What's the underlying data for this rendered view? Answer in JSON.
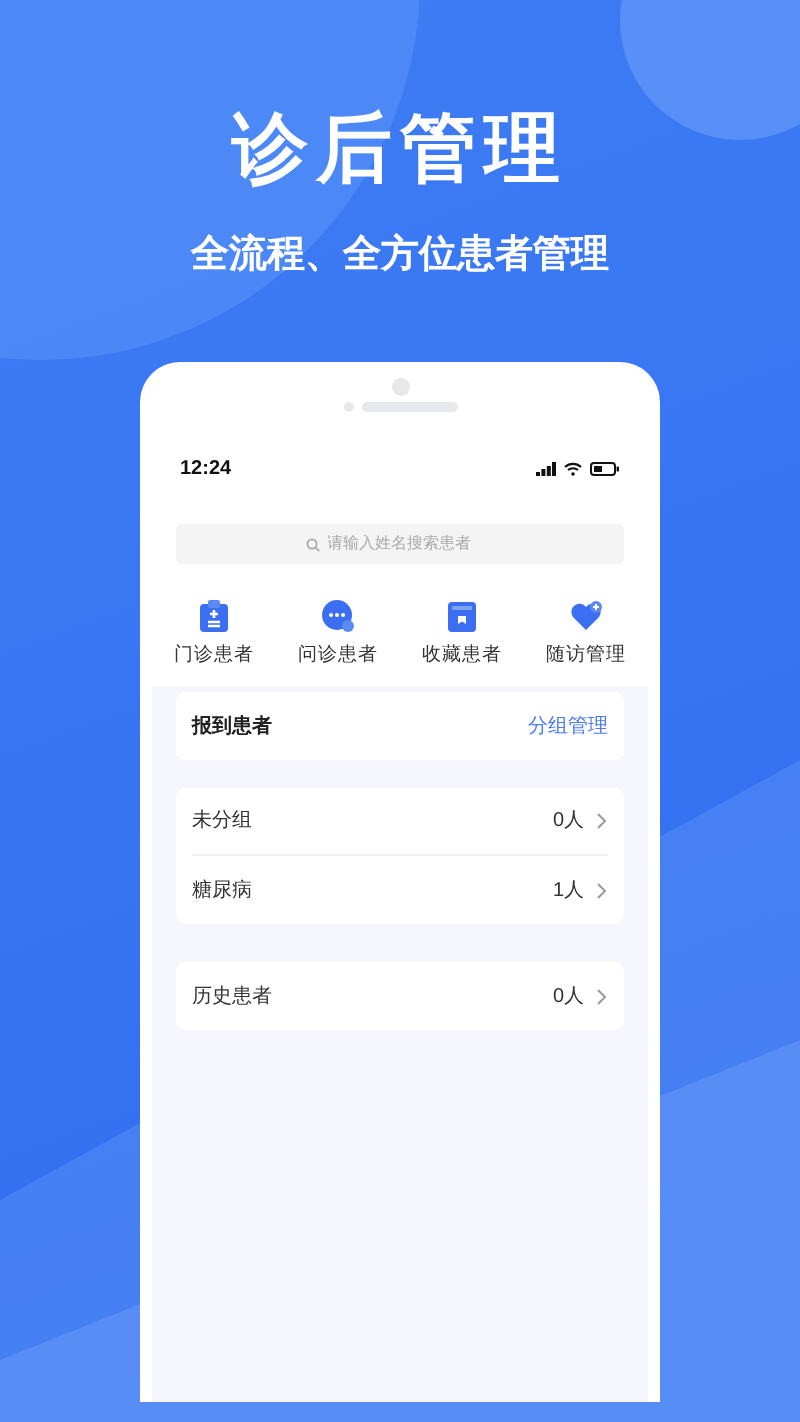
{
  "headline": "诊后管理",
  "subtitle": "全流程、全方位患者管理",
  "phone": {
    "status_bar": {
      "time": "12:24"
    },
    "search": {
      "placeholder": "请输入姓名搜索患者"
    },
    "shortcuts": [
      {
        "kind": "clinic",
        "label": "门诊患者"
      },
      {
        "kind": "chat",
        "label": "问诊患者"
      },
      {
        "kind": "bookmark",
        "label": "收藏患者"
      },
      {
        "kind": "heart",
        "label": "随访管理"
      }
    ],
    "checked_in": {
      "title": "报到患者",
      "action": "分组管理"
    },
    "groups": [
      {
        "name": "未分组",
        "count": "0人"
      },
      {
        "name": "糖尿病",
        "count": "1人"
      }
    ],
    "history": {
      "name": "历史患者",
      "count": "0人"
    }
  }
}
